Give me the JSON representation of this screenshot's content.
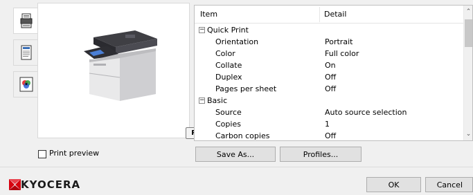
{
  "tabs": [
    {
      "name": "printer-tab",
      "icon": "printer-icon"
    },
    {
      "name": "document-tab",
      "icon": "document-icon"
    },
    {
      "name": "color-tab",
      "icon": "color-icon"
    }
  ],
  "preview": {
    "badge": "PCL XL",
    "print_preview_label": "Print preview"
  },
  "settings": {
    "header": {
      "item": "Item",
      "detail": "Detail"
    },
    "rows": [
      {
        "type": "group",
        "name": "Quick Print",
        "toggle": "−"
      },
      {
        "type": "item",
        "name": "Orientation",
        "value": "Portrait"
      },
      {
        "type": "item",
        "name": "Color",
        "value": "Full color"
      },
      {
        "type": "item",
        "name": "Collate",
        "value": "On"
      },
      {
        "type": "item",
        "name": "Duplex",
        "value": "Off"
      },
      {
        "type": "item",
        "name": "Pages per sheet",
        "value": "Off"
      },
      {
        "type": "group",
        "name": "Basic",
        "toggle": "−"
      },
      {
        "type": "item",
        "name": "Source",
        "value": "Auto source selection"
      },
      {
        "type": "item",
        "name": "Copies",
        "value": "1"
      },
      {
        "type": "item",
        "name": "Carbon copies",
        "value": "Off"
      }
    ]
  },
  "buttons": {
    "save_as": "Save As...",
    "profiles": "Profiles...",
    "ok": "OK",
    "cancel": "Cancel"
  },
  "brand": {
    "name": "KYOCERA",
    "color": "#d7000f"
  }
}
